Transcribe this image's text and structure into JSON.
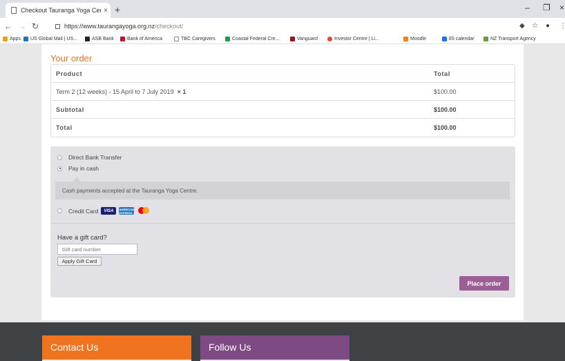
{
  "browser": {
    "tab_title": "Checkout Tauranga Yoga Centre",
    "tab_close": "×",
    "new_tab": "+",
    "url_host": "https://www.taurangayoga.org.nz",
    "url_path": "/checkout/",
    "bookmarks": [
      {
        "label": "Apps",
        "color": "#e8a21a"
      },
      {
        "label": "US Global Mail | US...",
        "color": "#1a73c9"
      },
      {
        "label": "ASB Bank",
        "color": "#222222"
      },
      {
        "label": "Bank of America",
        "color": "#c8102e"
      },
      {
        "label": "TBC Caregivers",
        "color": "#888888"
      },
      {
        "label": "Coastal Federal Cre...",
        "color": "#1f9e4a"
      },
      {
        "label": "Vanguard",
        "color": "#96151d"
      },
      {
        "label": "Investor Centre | Li...",
        "color": "#e04b2b"
      },
      {
        "label": "Moodle",
        "color": "#f98012"
      },
      {
        "label": "Eli calendar",
        "color": "#1a73e8"
      },
      {
        "label": "NZ Transport Agency",
        "color": "#6a9a3b"
      }
    ]
  },
  "order": {
    "title": "Your order",
    "head": {
      "product": "Product",
      "total": "Total"
    },
    "item": {
      "name": "Term 2 (12 weeks) - 15 April to 7 July 2019",
      "qty": "× 1",
      "total": "$100.00"
    },
    "subtotal": {
      "label": "Subtotal",
      "value": "$100.00"
    },
    "total": {
      "label": "Total",
      "value": "$100.00"
    }
  },
  "payment": {
    "options": [
      "Direct Bank Transfer",
      "Pay in cash",
      "Credit Card"
    ],
    "selected": "Pay in cash",
    "cash_notice": "Cash payments accepted at the Tauranga Yoga Centre.",
    "cards": {
      "visa": "VISA",
      "amex": "AMERICAN EXPRESS"
    },
    "gift_title": "Have a gift card?",
    "gift_placeholder": "Gift card number",
    "gift_button": "Apply Gift Card",
    "place_order": "Place order",
    "button_color": "#9b5f96"
  },
  "footer": {
    "contact": "Contact Us",
    "follow": "Follow Us",
    "contact_color": "#f0731f",
    "follow_color": "#7e4a84"
  }
}
